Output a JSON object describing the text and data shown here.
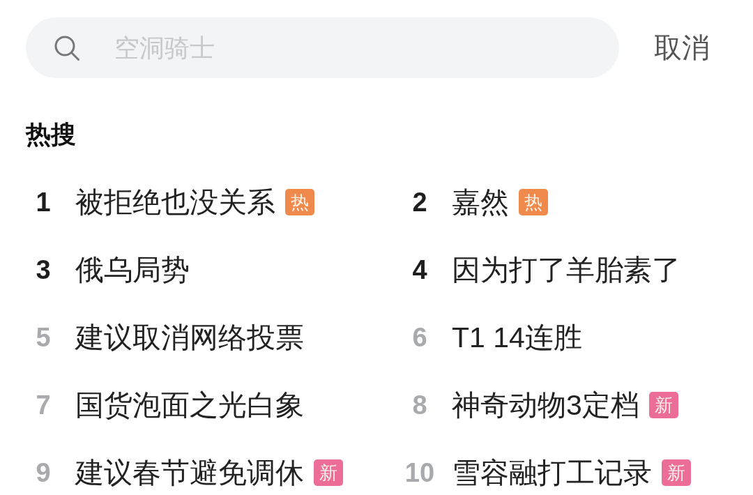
{
  "search": {
    "placeholder": "空洞骑士",
    "cancel": "取消"
  },
  "section_title": "热搜",
  "hot_searches": [
    {
      "rank": "1",
      "title": "被拒绝也没关系",
      "top": true,
      "badge": {
        "label": "热",
        "color": "#ef8a4c"
      }
    },
    {
      "rank": "2",
      "title": "嘉然",
      "top": true,
      "badge": {
        "label": "热",
        "color": "#ef8a4c"
      }
    },
    {
      "rank": "3",
      "title": "俄乌局势",
      "top": true
    },
    {
      "rank": "4",
      "title": "因为打了羊胎素了",
      "top": true
    },
    {
      "rank": "5",
      "title": "建议取消网络投票",
      "top": false
    },
    {
      "rank": "6",
      "title": "T1 14连胜",
      "top": false
    },
    {
      "rank": "7",
      "title": "国货泡面之光白象",
      "top": false
    },
    {
      "rank": "8",
      "title": "神奇动物3定档",
      "top": false,
      "badge": {
        "label": "新",
        "color": "#ec6d97"
      }
    },
    {
      "rank": "9",
      "title": "建议春节避免调休",
      "top": false,
      "badge": {
        "label": "新",
        "color": "#ec6d97"
      }
    },
    {
      "rank": "10",
      "title": "雪容融打工记录",
      "top": false,
      "badge": {
        "label": "新",
        "color": "#ec6d97"
      }
    }
  ]
}
